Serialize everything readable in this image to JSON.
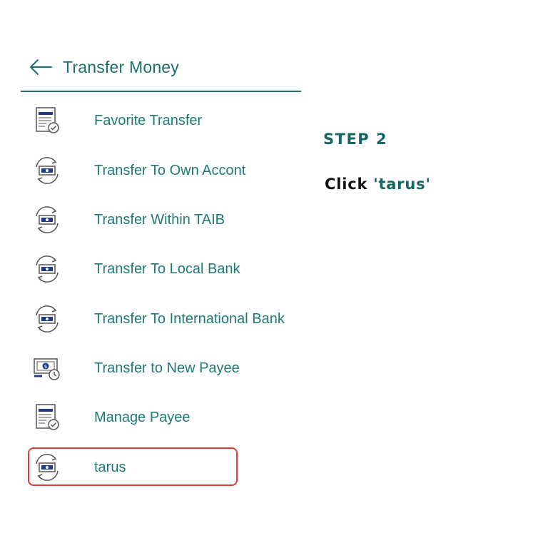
{
  "header": {
    "title": "Transfer Money",
    "back_icon": "arrow-left-icon"
  },
  "menu": {
    "items": [
      {
        "label": "Favorite Transfer",
        "icon": "document-check-icon"
      },
      {
        "label": "Transfer To Own Accont",
        "icon": "money-cycle-icon"
      },
      {
        "label": "Transfer Within TAIB",
        "icon": "money-cycle-icon"
      },
      {
        "label": "Transfer To Local Bank",
        "icon": "money-cycle-icon"
      },
      {
        "label": "Transfer To International Bank",
        "icon": "money-cycle-icon"
      },
      {
        "label": "Transfer to New Payee",
        "icon": "money-clock-icon"
      },
      {
        "label": "Manage Payee",
        "icon": "document-check-icon"
      },
      {
        "label": "tarus",
        "icon": "money-cycle-icon"
      }
    ]
  },
  "guide": {
    "step": "STEP 2",
    "instruction_prefix": "Click",
    "instruction_target": "'tarus'"
  },
  "colors": {
    "accent": "#19706d",
    "highlight": "#e23a3a",
    "icon_navy": "#1f3a8a"
  }
}
